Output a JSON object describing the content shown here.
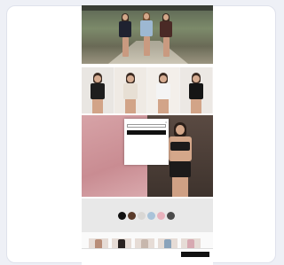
{
  "site": {
    "logo": "",
    "nav_visible": true
  },
  "promo": {
    "heading": "",
    "shop_label": "",
    "right_caption": ""
  },
  "popup": {
    "title": "",
    "close_glyph": "×",
    "lines": [
      "",
      "",
      ""
    ],
    "input_label": "",
    "input_placeholder": "",
    "submit_label": ""
  },
  "swatches": {
    "title": "",
    "colors": [
      {
        "hex": "#111111",
        "label": ""
      },
      {
        "hex": "#5a3b2a",
        "label": ""
      },
      {
        "hex": "#d9d7d4",
        "label": ""
      },
      {
        "hex": "#a9c3d9",
        "label": ""
      },
      {
        "hex": "#e8b2bd",
        "label": ""
      },
      {
        "hex": "#4b4b4b",
        "label": ""
      }
    ]
  },
  "products": {
    "title": ""
  },
  "footer": {
    "logo": "",
    "text": "",
    "button": ""
  },
  "colors": {
    "page_bg": "#eef0f6",
    "pink_panel": "#cf9298",
    "dark_panel": "#463a33",
    "button": "#111111"
  }
}
